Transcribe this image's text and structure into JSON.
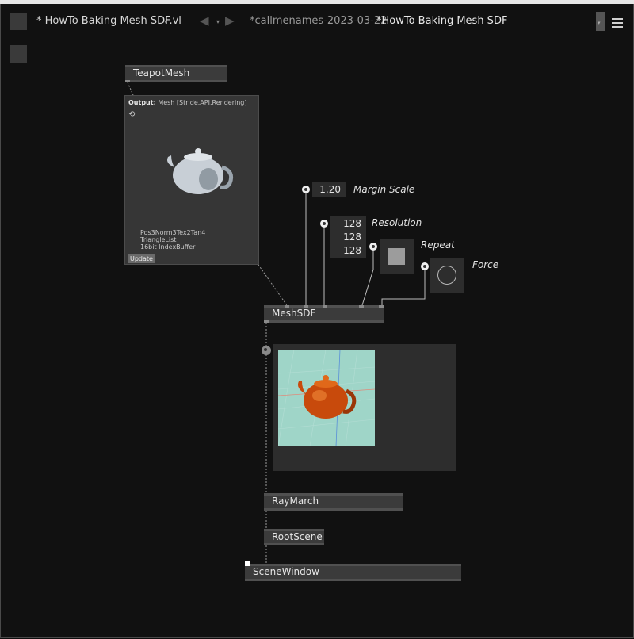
{
  "header": {
    "title": "* HowTo Baking Mesh SDF.vl"
  },
  "tabs": [
    {
      "label": "*callmenames-2023-03-22",
      "active": false
    },
    {
      "label": "*HowTo Baking Mesh SDF",
      "active": true
    }
  ],
  "icons": {
    "dropdown_glyph": "▾",
    "back_glyph": "◀",
    "forward_glyph": "▶",
    "refresh_glyph": "⟲",
    "menu": "hamburger-menu-icon",
    "bang": "bang-circle-icon"
  },
  "nodes": {
    "teapot": "TeapotMesh",
    "meshsdf": "MeshSDF",
    "raymarch": "RayMarch",
    "rootscene": "RootScene",
    "scenewindow": "SceneWindow"
  },
  "tooltip": {
    "output_label": "Output:",
    "type": "Mesh [Stride.API.Rendering]",
    "lines": [
      "Pos3Norm3Tex2Tan4",
      "TriangleList",
      "16bit IndexBuffer"
    ],
    "update_label": "Update"
  },
  "iobox": {
    "margin_scale": {
      "label": "Margin Scale",
      "value": "1.20"
    },
    "resolution": {
      "label": "Resolution",
      "values": [
        "128",
        "128",
        "128"
      ]
    },
    "repeat": {
      "label": "Repeat",
      "state": true
    },
    "force": {
      "label": "Force"
    }
  },
  "colors": {
    "canvas": "#111111",
    "node": "#3b3b3b",
    "iobox": "#2d2d2d",
    "render_bg": "#9fd5c8",
    "teapot_render": "#c84a0c"
  }
}
